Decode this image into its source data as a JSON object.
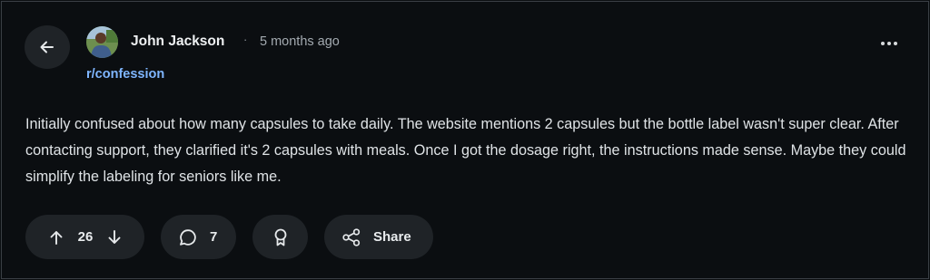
{
  "post": {
    "author": "John Jackson",
    "separator": "·",
    "time": "5 months ago",
    "community": "r/confession",
    "body": "Initially confused about how many capsules to take daily. The website mentions 2 capsules but the bottle label wasn't super clear. After contacting support, they clarified it's 2 capsules with meals. Once I got the dosage right, the instructions made sense. Maybe they could simplify the labeling for seniors like me."
  },
  "actions": {
    "vote_count": "26",
    "comment_count": "7",
    "share_label": "Share"
  },
  "icons": {
    "back": "arrow-left-icon",
    "upvote": "arrow-up-icon",
    "downvote": "arrow-down-icon",
    "comment": "speech-bubble-icon",
    "award": "award-ribbon-icon",
    "share": "share-nodes-icon",
    "more": "three-dots-icon"
  },
  "colors": {
    "background": "#0b0e11",
    "pill": "#1f2327",
    "community_link": "#7fb6ff",
    "text": "#dfe3e6"
  }
}
